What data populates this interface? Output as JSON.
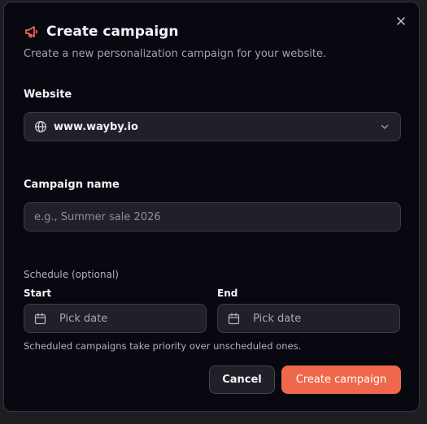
{
  "dialog": {
    "title": "Create campaign",
    "subtitle": "Create a new personalization campaign for your website.",
    "close_icon": "x-icon",
    "title_icon": "megaphone-icon"
  },
  "website": {
    "label": "Website",
    "value": "www.wayby.io",
    "icon": "globe-icon",
    "chevron_icon": "chevron-down-icon"
  },
  "campaign_name": {
    "label": "Campaign name",
    "placeholder": "e.g., Summer sale 2026",
    "value": ""
  },
  "schedule": {
    "label": "Schedule (optional)",
    "start": {
      "label": "Start",
      "placeholder": "Pick date",
      "icon": "calendar-icon"
    },
    "end": {
      "label": "End",
      "placeholder": "Pick date",
      "icon": "calendar-icon"
    },
    "hint": "Scheduled campaigns take priority over unscheduled ones."
  },
  "actions": {
    "cancel_label": "Cancel",
    "create_label": "Create campaign"
  },
  "colors": {
    "accent": "#f0684c",
    "background": "#070810",
    "field": "#1f2028"
  }
}
